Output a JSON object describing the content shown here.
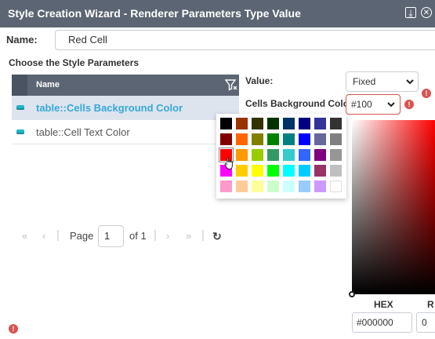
{
  "window": {
    "title": "Style Creation Wizard - Renderer Parameters Type Value",
    "restore_icon": "restore-icon",
    "close_icon": "close-icon",
    "restore_glyph": "⤓",
    "close_glyph": "✕"
  },
  "name_field": {
    "label": "Name:",
    "value": "Red Cell"
  },
  "section_title": "Choose the Style Parameters",
  "grid": {
    "column_header": "Name",
    "filter_icon": "filter-icon",
    "rows": [
      {
        "label": "table::Cells Background Color",
        "selected": true,
        "icon": "parameter-icon"
      },
      {
        "label": "table::Cell Text Color",
        "selected": false,
        "icon": "parameter-icon"
      }
    ]
  },
  "pager": {
    "first": "«",
    "prev": "‹",
    "page_label": "Page",
    "page_value": "1",
    "of_label": "of 1",
    "next": "›",
    "last": "»",
    "separator": "|",
    "refresh": "↻"
  },
  "value_field": {
    "label": "Value:",
    "selected": "Fixed"
  },
  "color_field": {
    "label": "Cells Background Color:",
    "selected": "#100",
    "warning": "!"
  },
  "value_warning": "!",
  "palette": {
    "colors": [
      [
        "#000000",
        "#993300",
        "#333300",
        "#003300",
        "#003366",
        "#000080",
        "#333399",
        "#333333"
      ],
      [
        "#800000",
        "#ff6600",
        "#808000",
        "#008000",
        "#008080",
        "#0000ff",
        "#666699",
        "#808080"
      ],
      [
        "#ff0000",
        "#ff9900",
        "#99cc00",
        "#339966",
        "#33cccc",
        "#3366ff",
        "#800080",
        "#969696"
      ],
      [
        "#ff00ff",
        "#ffcc00",
        "#ffff00",
        "#00ff00",
        "#00ffff",
        "#00ccff",
        "#993366",
        "#c0c0c0"
      ],
      [
        "#ff99cc",
        "#ffcc99",
        "#ffff99",
        "#ccffcc",
        "#ccffff",
        "#99ccff",
        "#cc99ff",
        "#ffffff"
      ]
    ],
    "selected": "#ff0000"
  },
  "picker": {
    "hex_label": "HEX",
    "r_label": "R",
    "hex_value": "#000000",
    "r_value": "0"
  },
  "footer_warning": "!"
}
